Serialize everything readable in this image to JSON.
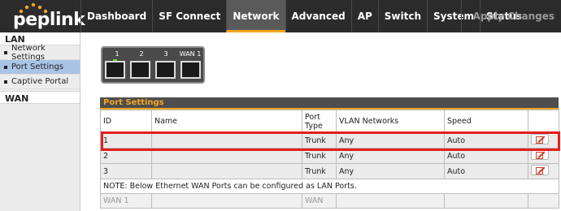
{
  "logo": {
    "text": "peplink"
  },
  "nav": {
    "tabs": [
      "Dashboard",
      "SF Connect",
      "Network",
      "Advanced",
      "AP",
      "Switch",
      "System",
      "Status"
    ],
    "active": "Network",
    "apply_label": "Apply Changes"
  },
  "sidebar": {
    "lan_heading": "LAN",
    "items": [
      "Network Settings",
      "Port Settings",
      "Captive Portal"
    ],
    "active_item": "Port Settings",
    "wan_heading": "WAN"
  },
  "ports": {
    "labels": [
      "1",
      "2",
      "3",
      "WAN 1"
    ],
    "link_up_port": "1"
  },
  "table": {
    "title": "Port Settings",
    "headers": {
      "id": "ID",
      "name": "Name",
      "port_type": "Port Type",
      "vlan": "VLAN Networks",
      "speed": "Speed"
    },
    "rows": [
      {
        "id": "1",
        "name": "",
        "port_type": "Trunk",
        "vlan": "Any",
        "speed": "Auto"
      },
      {
        "id": "2",
        "name": "",
        "port_type": "Trunk",
        "vlan": "Any",
        "speed": "Auto"
      },
      {
        "id": "3",
        "name": "",
        "port_type": "Trunk",
        "vlan": "Any",
        "speed": "Auto"
      }
    ],
    "note": "NOTE: Below Ethernet WAN Ports can be configured as LAN Ports.",
    "wan_row": {
      "id": "WAN 1",
      "port_type": "WAN"
    }
  },
  "colors": {
    "accent": "#f5a623",
    "header_bg": "#2b2b2b",
    "selected_sidebar": "#a9c4e6",
    "highlight": "#e0201b"
  },
  "icons": {
    "edit": "edit-pencil-icon"
  }
}
